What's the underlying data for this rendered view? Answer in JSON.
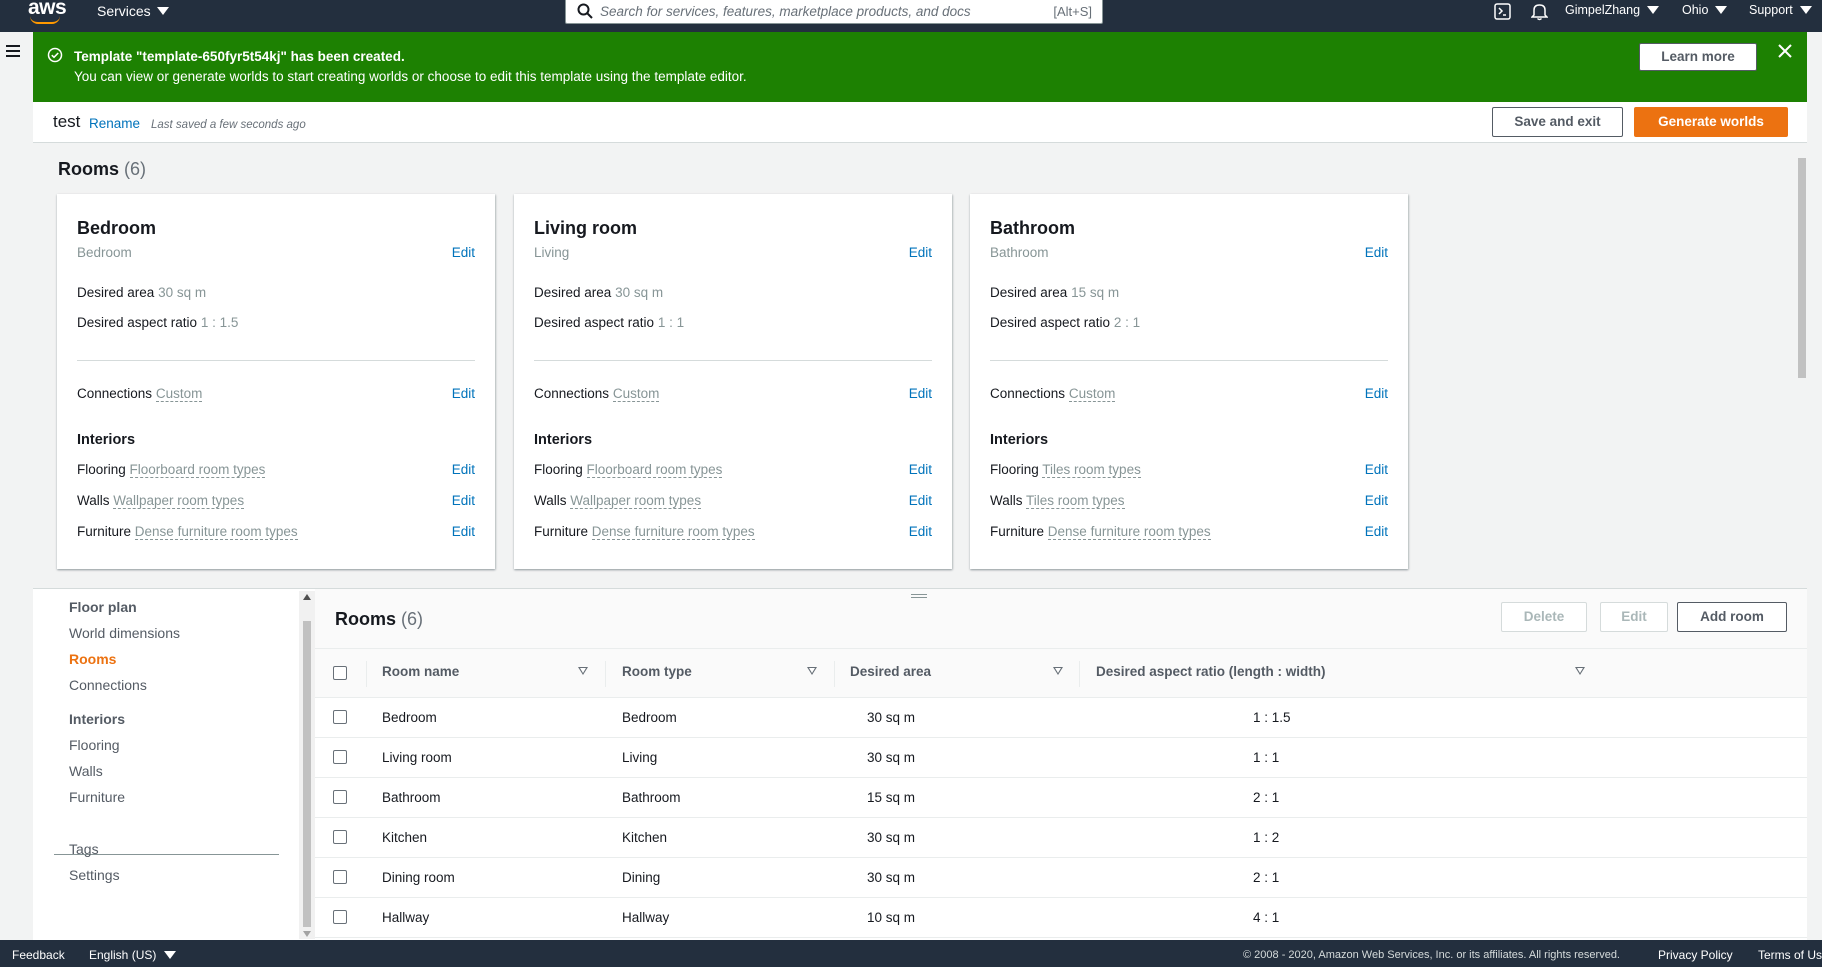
{
  "topnav": {
    "logo": "aws",
    "services_label": "Services",
    "search_placeholder": "Search for services, features, marketplace products, and docs",
    "search_shortcut": "[Alt+S]",
    "user": "GimpelZhang",
    "region": "Ohio",
    "support": "Support"
  },
  "flash": {
    "title": "Template \"template-650fyr5t54kj\" has been created.",
    "body": "You can view or generate worlds to start creating worlds or choose to edit this template using the template editor.",
    "learn_more": "Learn more",
    "color": "#1d8102"
  },
  "header": {
    "name": "test",
    "rename": "Rename",
    "saved": "Last saved a few seconds ago",
    "save_exit": "Save and exit",
    "generate": "Generate worlds",
    "accent": "#ec7211"
  },
  "rooms_section": {
    "title": "Rooms",
    "count": "(6)",
    "labels": {
      "edit": "Edit",
      "desired_area": "Desired area",
      "desired_aspect_ratio": "Desired aspect ratio",
      "connections": "Connections",
      "interiors": "Interiors",
      "flooring": "Flooring",
      "walls": "Walls",
      "furniture": "Furniture"
    },
    "cards": [
      {
        "name": "Bedroom",
        "type": "Bedroom",
        "area": "30 sq m",
        "ratio": "1 : 1.5",
        "connections": "Custom",
        "flooring": "Floorboard room types",
        "walls": "Wallpaper room types",
        "furniture": "Dense furniture room types"
      },
      {
        "name": "Living room",
        "type": "Living",
        "area": "30 sq m",
        "ratio": "1 : 1",
        "connections": "Custom",
        "flooring": "Floorboard room types",
        "walls": "Wallpaper room types",
        "furniture": "Dense furniture room types"
      },
      {
        "name": "Bathroom",
        "type": "Bathroom",
        "area": "15 sq m",
        "ratio": "2 : 1",
        "connections": "Custom",
        "flooring": "Tiles room types",
        "walls": "Tiles room types",
        "furniture": "Dense furniture room types"
      }
    ]
  },
  "sidebar": {
    "floor_plan": "Floor plan",
    "world_dimensions": "World dimensions",
    "rooms": "Rooms",
    "connections": "Connections",
    "interiors": "Interiors",
    "flooring": "Flooring",
    "walls": "Walls",
    "furniture": "Furniture",
    "tags": "Tags",
    "settings": "Settings"
  },
  "table": {
    "title": "Rooms",
    "count": "(6)",
    "delete": "Delete",
    "edit": "Edit",
    "add": "Add room",
    "columns": [
      "Room name",
      "Room type",
      "Desired area",
      "Desired aspect ratio (length : width)"
    ],
    "rows": [
      [
        "Bedroom",
        "Bedroom",
        "30 sq m",
        "1 : 1.5"
      ],
      [
        "Living room",
        "Living",
        "30 sq m",
        "1 : 1"
      ],
      [
        "Bathroom",
        "Bathroom",
        "15 sq m",
        "2 : 1"
      ],
      [
        "Kitchen",
        "Kitchen",
        "30 sq m",
        "1 : 2"
      ],
      [
        "Dining room",
        "Dining",
        "30 sq m",
        "2 : 1"
      ],
      [
        "Hallway",
        "Hallway",
        "10 sq m",
        "4 : 1"
      ]
    ]
  },
  "footer": {
    "feedback": "Feedback",
    "language": "English (US)",
    "copyright": "© 2008 - 2020, Amazon Web Services, Inc. or its affiliates. All rights reserved.",
    "privacy": "Privacy Policy",
    "terms": "Terms of Us"
  }
}
